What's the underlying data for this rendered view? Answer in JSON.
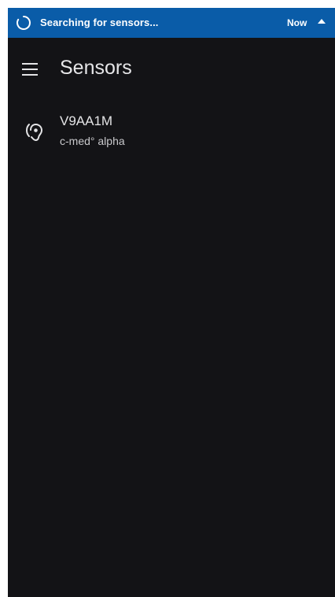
{
  "notification": {
    "text": "Searching for sensors...",
    "time": "Now",
    "icon": "spinner-icon",
    "expand_icon": "chevron-up-icon",
    "color": "#0a5ca8"
  },
  "header": {
    "menu_icon": "menu-icon",
    "title": "Sensors"
  },
  "sensors": [
    {
      "icon": "hearing-aid-icon",
      "name": "V9AA1M",
      "model": "c-med° alpha"
    }
  ],
  "colors": {
    "background": "#131316",
    "text": "#e4e4e6",
    "subtext": "#c9c9cc"
  }
}
